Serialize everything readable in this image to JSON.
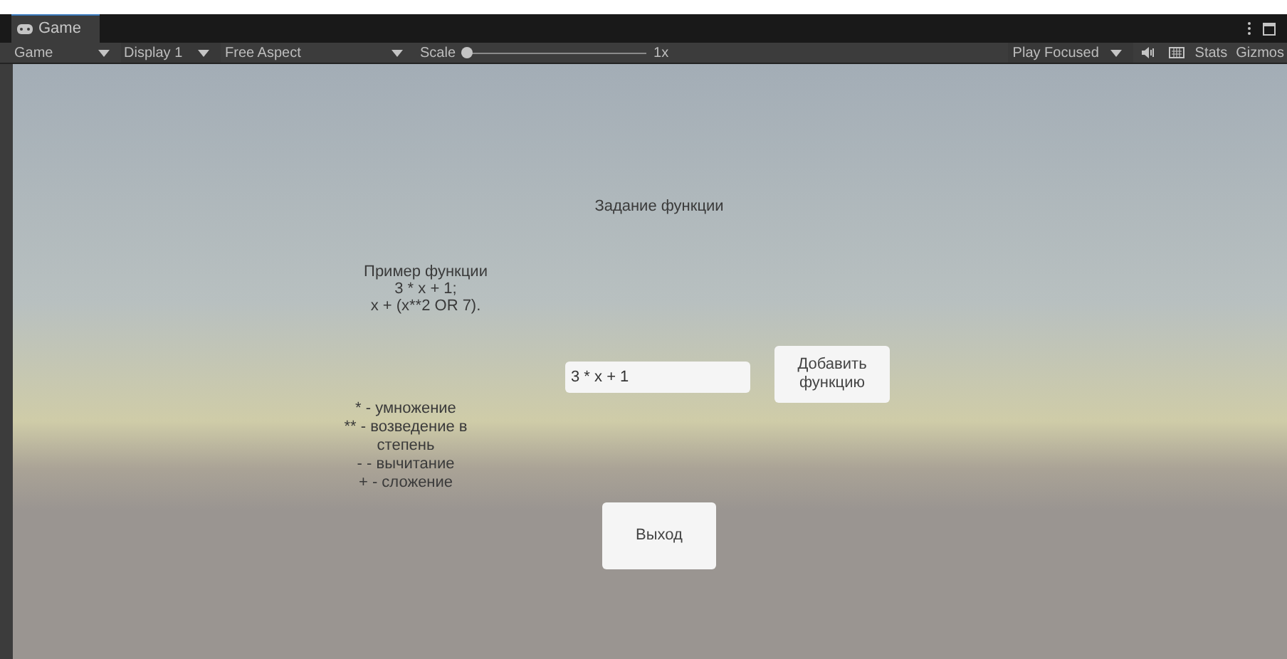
{
  "tab": {
    "label": "Game",
    "selected": true
  },
  "toolbar": {
    "view": "Game",
    "display": "Display 1",
    "aspect": "Free Aspect",
    "scale_label": "Scale",
    "scale": {
      "level": 0
    },
    "scale_reading": "1x",
    "play_mode": "Play Focused",
    "stats": "Stats",
    "gizmos": "Gizmos"
  },
  "game": {
    "title": "Задание функции",
    "example": [
      "Пример функции",
      "3 * x + 1;",
      "x + (x**2 OR 7)."
    ],
    "input": {
      "value": "3 * x + 1"
    },
    "add_button": "Добавить функцию",
    "legend": [
      "* - умножение",
      "** - возведение в степень",
      "- - вычитание",
      "+ - сложение"
    ],
    "exit_button": "Выход"
  }
}
